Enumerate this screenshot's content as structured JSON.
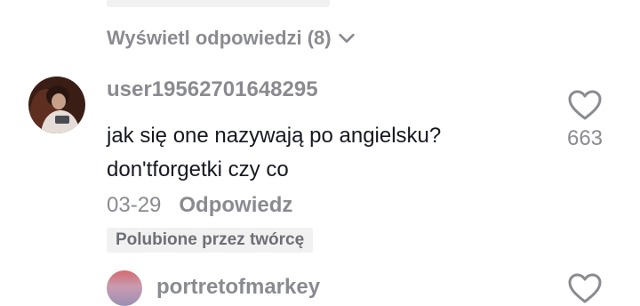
{
  "replies_toggle": {
    "label": "Wyświetl odpowiedzi (8)",
    "icon": "chevron-down-icon"
  },
  "comment": {
    "username": "user19562701648295",
    "text_line1": "jak się one nazywają po angielsku?",
    "text_line2": "don'tforgetki czy co",
    "date": "03-29",
    "reply_label": "Odpowiedz",
    "creator_badge": "Polubione przez twórcę",
    "like_count": "663",
    "like_icon": "heart-outline-icon"
  },
  "next_comment": {
    "username": "portretofmarkey",
    "like_icon": "heart-outline-icon"
  },
  "colors": {
    "text": "#161823",
    "muted": "#8a8b91",
    "badge_bg": "#f1f1f2"
  }
}
